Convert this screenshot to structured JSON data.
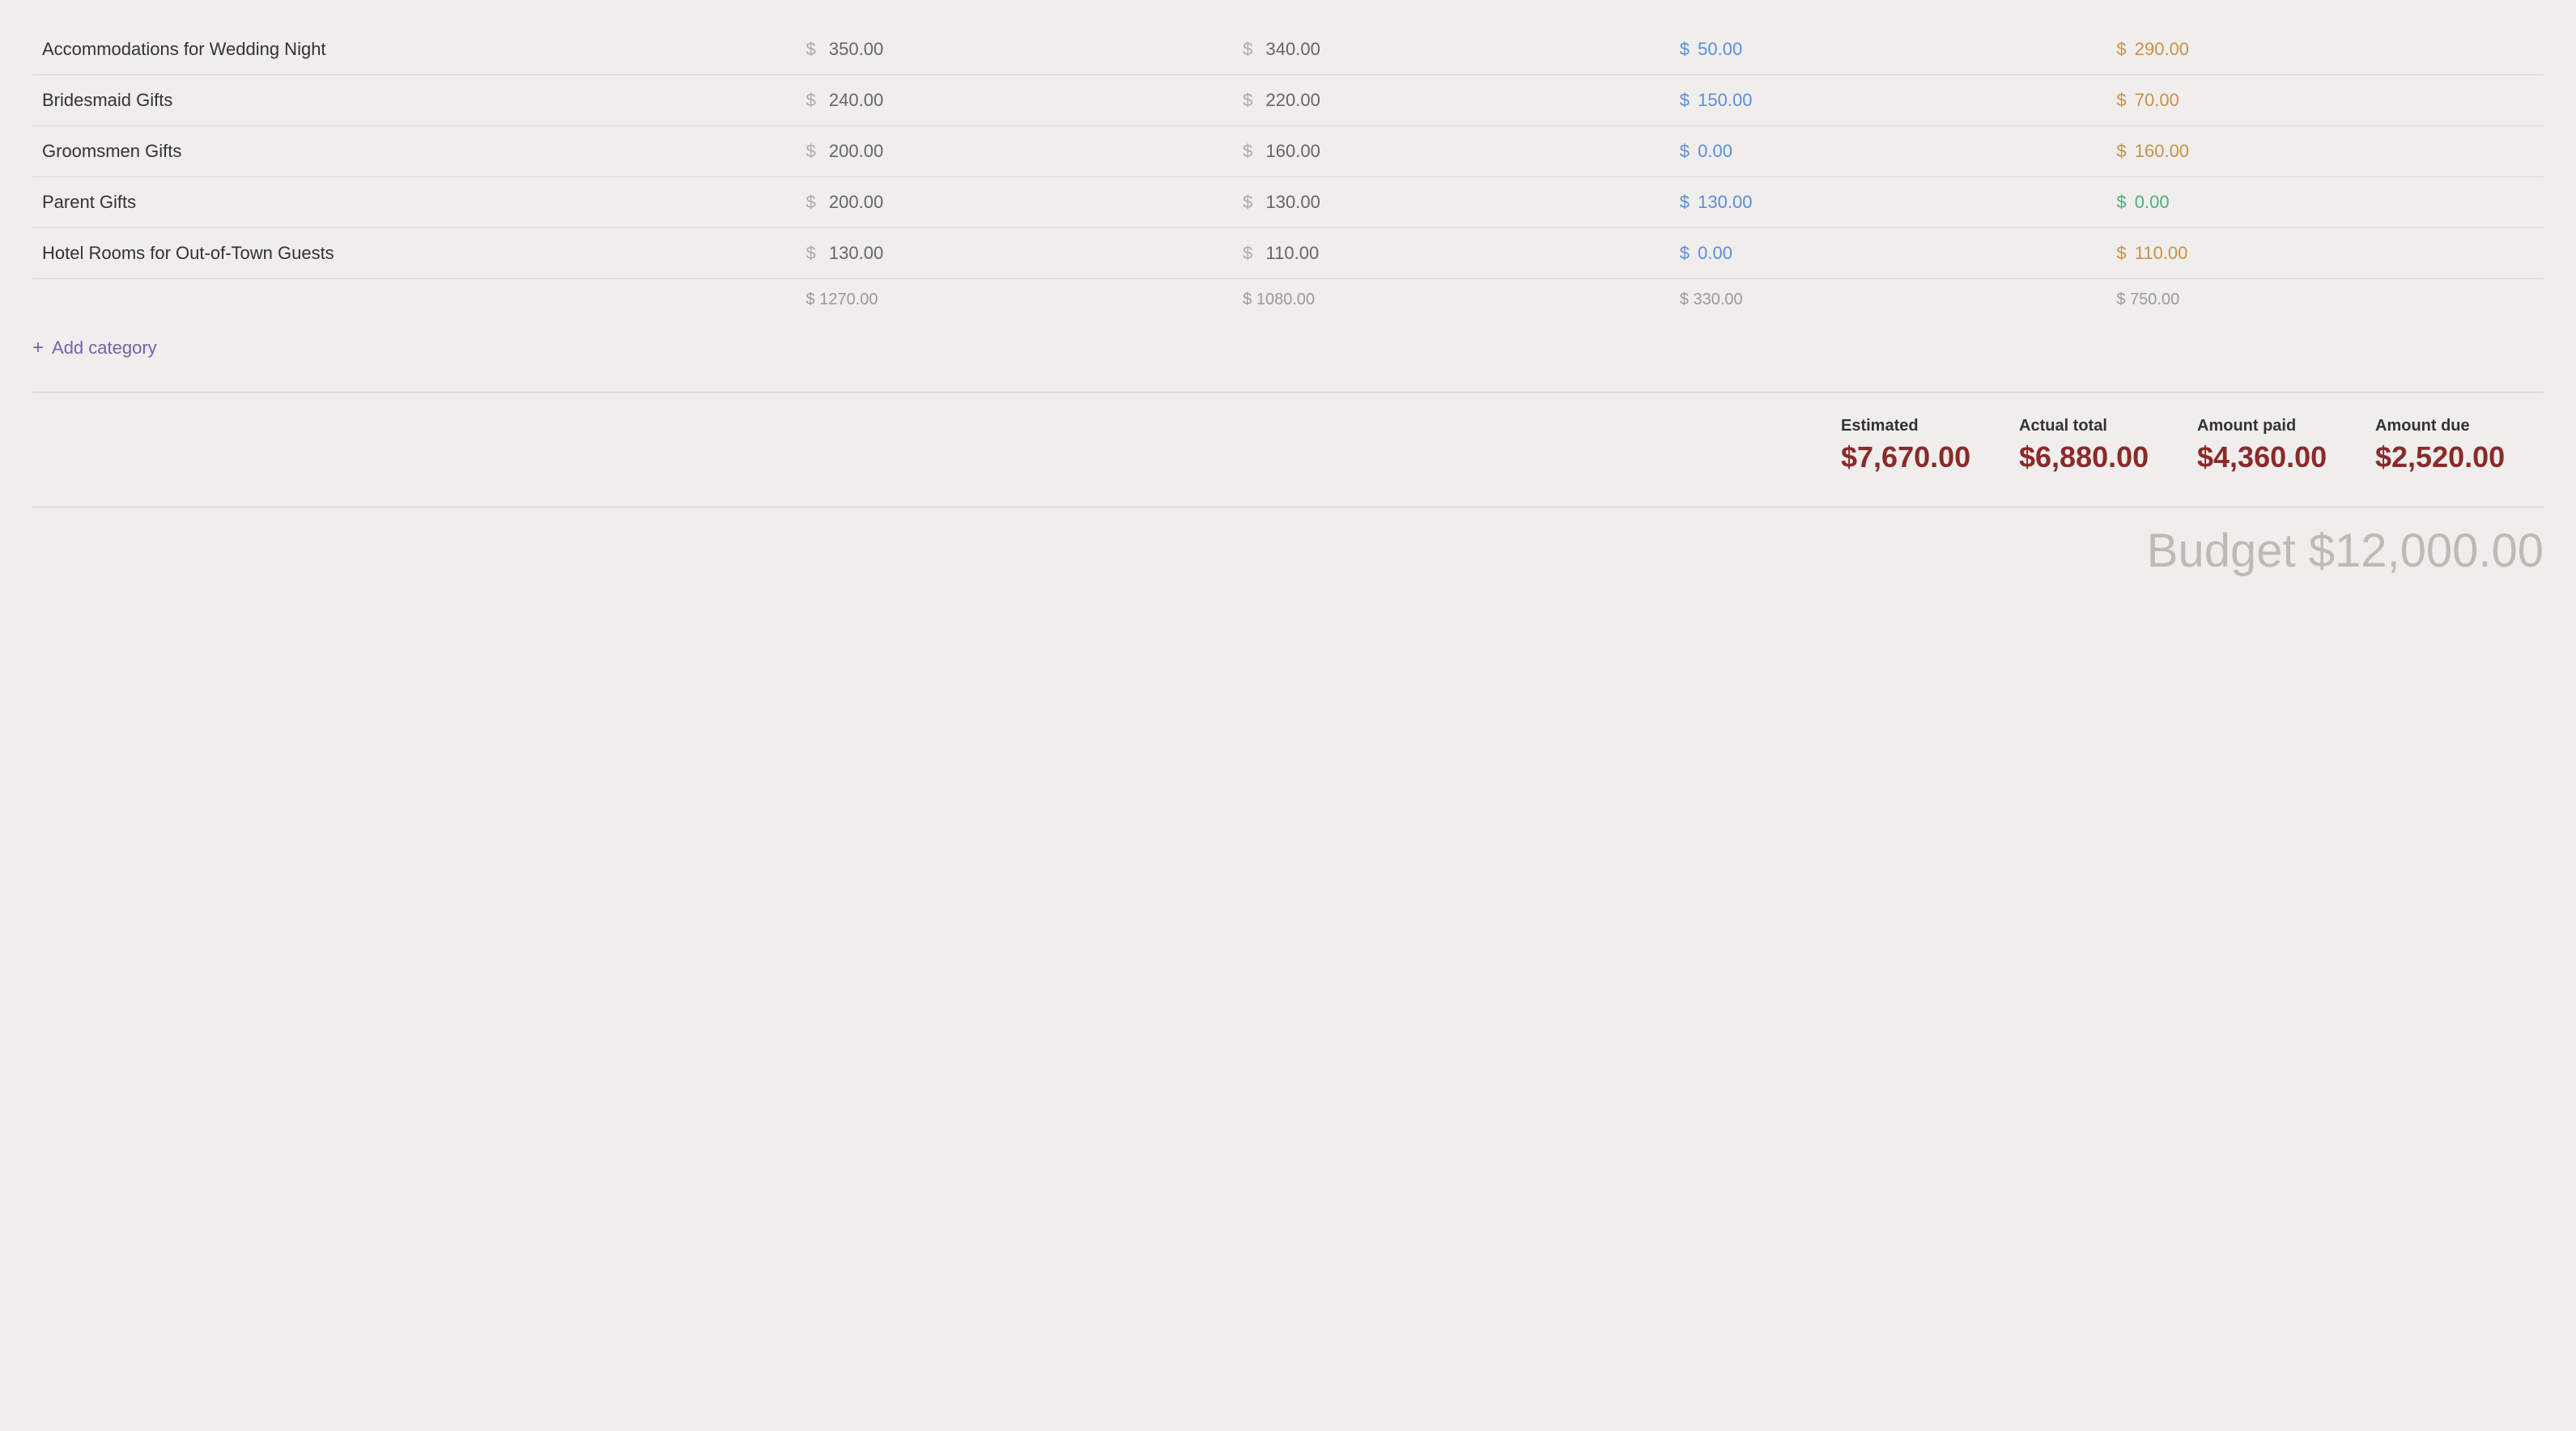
{
  "rows": [
    {
      "label": "Accommodations for Wedding Night",
      "estimated": "350.00",
      "actual": "340.00",
      "paid": "50.00",
      "due": "290.00",
      "due_color": "orange",
      "paid_color": "blue"
    },
    {
      "label": "Bridesmaid Gifts",
      "estimated": "240.00",
      "actual": "220.00",
      "paid": "150.00",
      "due": "70.00",
      "due_color": "orange",
      "paid_color": "blue"
    },
    {
      "label": "Groomsmen Gifts",
      "estimated": "200.00",
      "actual": "160.00",
      "paid": "0.00",
      "due": "160.00",
      "due_color": "orange",
      "paid_color": "blue"
    },
    {
      "label": "Parent Gifts",
      "estimated": "200.00",
      "actual": "130.00",
      "paid": "130.00",
      "due": "0.00",
      "due_color": "green",
      "paid_color": "blue"
    },
    {
      "label": "Hotel Rooms for Out-of-Town Guests",
      "estimated": "130.00",
      "actual": "110.00",
      "paid": "0.00",
      "due": "110.00",
      "due_color": "orange",
      "paid_color": "blue"
    }
  ],
  "subtotals": {
    "estimated": "$ 1270.00",
    "actual": "$ 1080.00",
    "paid": "$ 330.00",
    "due": "$ 750.00"
  },
  "add_category_label": "Add category",
  "totals": {
    "estimated_label": "Estimated",
    "estimated_value": "$7,670.00",
    "actual_label": "Actual total",
    "actual_value": "$6,880.00",
    "paid_label": "Amount paid",
    "paid_value": "$4,360.00",
    "due_label": "Amount due",
    "due_value": "$2,520.00"
  },
  "budget_footer": "Budget $12,000.00",
  "colors": {
    "blue": "#5b8dd9",
    "orange": "#c8914a",
    "green": "#4caf7d",
    "purple": "#7b5ea7",
    "dark_red": "#8b2a2a"
  }
}
